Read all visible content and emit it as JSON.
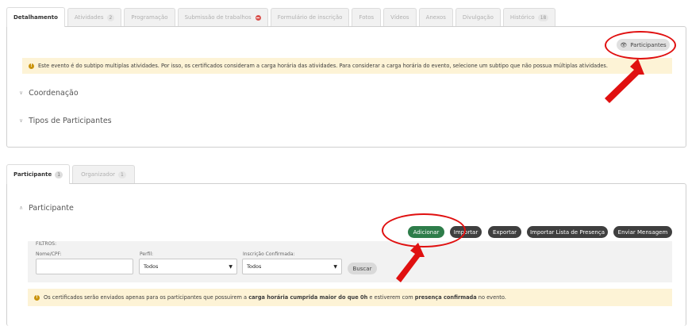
{
  "top_tabs": [
    {
      "label": "Detalhamento",
      "badge": null,
      "active": true
    },
    {
      "label": "Atividades",
      "badge": "2",
      "active": false
    },
    {
      "label": "Programação",
      "badge": null,
      "active": false
    },
    {
      "label": "Submissão de trabalhos",
      "badge": null,
      "active": false,
      "icon": "minus-circle-icon"
    },
    {
      "label": "Formulário de inscrição",
      "badge": null,
      "active": false
    },
    {
      "label": "Fotos",
      "badge": null,
      "active": false
    },
    {
      "label": "Vídeos",
      "badge": null,
      "active": false
    },
    {
      "label": "Anexos",
      "badge": null,
      "active": false
    },
    {
      "label": "Divulgação",
      "badge": null,
      "active": false
    },
    {
      "label": "Histórico",
      "badge": "18",
      "active": false
    }
  ],
  "detail": {
    "participants_button": "Participantes",
    "alert": "Este evento é do subtipo multiplas atividades. Por isso, os certificados consideram a carga horária das atividades. Para considerar a carga horária do evento, selecione um subtipo que não possua múltiplas atividades.",
    "sections": [
      "Coordenação",
      "Tipos de Participantes"
    ]
  },
  "bottom_tabs": [
    {
      "label": "Participante",
      "badge": "1",
      "active": true
    },
    {
      "label": "Organizador",
      "badge": "1",
      "active": false
    }
  ],
  "participants": {
    "section_title": "Participante",
    "actions": {
      "add": "Adicionar",
      "import": "Importar",
      "export": "Exportar",
      "import_attendance": "Importar Lista de Presença",
      "send_message": "Enviar Mensagem"
    },
    "filters": {
      "title": "FILTROS:",
      "name_label": "Nome/CPF:",
      "name_value": "",
      "profile_label": "Perfil:",
      "profile_value": "Todos",
      "confirmed_label": "Inscrição Confirmada:",
      "confirmed_value": "Todos",
      "search_button": "Buscar"
    },
    "notice": {
      "part1": "Os certificados serão enviados apenas para os participantes que possuirem a ",
      "bold1": "carga horária cumprida maior do que 0h",
      "part2": " e estiverem com ",
      "bold2": "presença confirmada",
      "part3": " no evento."
    }
  },
  "colors": {
    "accent_red": "#e01010",
    "green": "#2e7d4a",
    "dark_button": "#3f3f3f",
    "alert_bg": "#fdf3d6"
  }
}
